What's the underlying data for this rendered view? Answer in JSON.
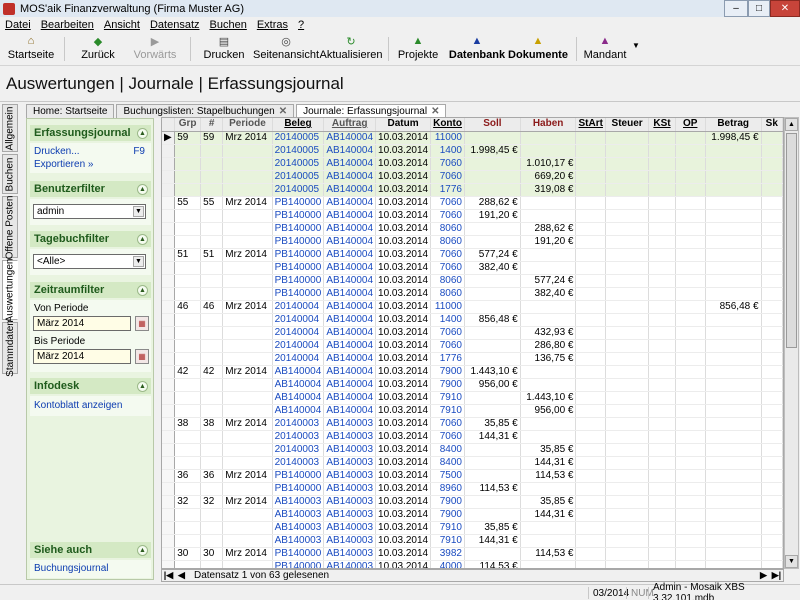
{
  "window": {
    "title": "MOS'aik Finanzverwaltung (Firma Muster AG)",
    "minimize": "–",
    "maximize": "□",
    "close": "✕"
  },
  "menu": [
    "Datei",
    "Bearbeiten",
    "Ansicht",
    "Datensatz",
    "Buchen",
    "Extras",
    "?"
  ],
  "toolbar": {
    "startseite": "Startseite",
    "zurueck": "Zurück",
    "vorwaerts": "Vorwärts",
    "drucken": "Drucken",
    "seitenansicht": "Seitenansicht",
    "aktualisieren": "Aktualisieren",
    "projekte": "Projekte",
    "datenbank": "Datenbank",
    "dokumente": "Dokumente",
    "mandant": "Mandant",
    "mandant_arrow": "▼",
    "icons": {
      "startseite": "⌂",
      "zurueck": "◆",
      "vorwaerts": "▶",
      "drucken": "▤",
      "seitenansicht": "◎",
      "aktualisieren": "↻",
      "projekte": "▲",
      "datenbank": "▲",
      "dokumente": "▲",
      "mandant": "▲"
    }
  },
  "page_title": "Auswertungen | Journale | Erfassungsjournal",
  "vertical_tabs": [
    "Allgemein",
    "Buchen",
    "Offene Posten",
    "Auswertungen",
    "Stammdaten"
  ],
  "doc_tabs": [
    {
      "label": "Home: Startseite",
      "close": ""
    },
    {
      "label": "Buchungslisten: Stapelbuchungen",
      "close": "✕"
    },
    {
      "label": "Journale: Erfassungsjournal",
      "close": "✕"
    }
  ],
  "sidebar": {
    "arrow": "▲",
    "erfassungsjournal": {
      "title": "Erfassungsjournal",
      "drucken": "Drucken...",
      "drucken_key": "F9",
      "exportieren": "Exportieren »"
    },
    "benutzerfilter": {
      "title": "Benutzerfilter",
      "value": "admin"
    },
    "tagebuchfilter": {
      "title": "Tagebuchfilter",
      "value": "<Alle>"
    },
    "zeitraumfilter": {
      "title": "Zeitraumfilter",
      "von_label": "Von Periode",
      "von_value": "März 2014",
      "bis_label": "Bis Periode",
      "bis_value": "März 2014",
      "cal_icon": "▦"
    },
    "infodesk": {
      "title": "Infodesk",
      "link": "Kontoblatt anzeigen"
    },
    "siehe_auch": {
      "title": "Siehe auch",
      "link": "Buchungsjournal"
    }
  },
  "grid": {
    "columns": [
      "Grp",
      "#",
      "Periode",
      "Beleg",
      "Auftrag",
      "Datum",
      "Konto",
      "Soll",
      "Haben",
      "StArt",
      "Steuer",
      "KSt",
      "OP",
      "Betrag",
      "Sk"
    ],
    "current_marker": "▶",
    "rows": [
      [
        "59",
        "59",
        "Mrz 2014",
        "20140005",
        "AB140004",
        "10.03.2014",
        "11000",
        "",
        "",
        "",
        "",
        "",
        "",
        "1.998,45 €",
        ""
      ],
      [
        "",
        "",
        "",
        "20140005",
        "AB140004",
        "10.03.2014",
        "1400",
        "1.998,45 €",
        "",
        "",
        "",
        "",
        "",
        "",
        ""
      ],
      [
        "",
        "",
        "",
        "20140005",
        "AB140004",
        "10.03.2014",
        "7060",
        "",
        "1.010,17 €",
        "",
        "",
        "",
        "",
        "",
        ""
      ],
      [
        "",
        "",
        "",
        "20140005",
        "AB140004",
        "10.03.2014",
        "7060",
        "",
        "669,20 €",
        "",
        "",
        "",
        "",
        "",
        ""
      ],
      [
        "",
        "",
        "",
        "20140005",
        "AB140004",
        "10.03.2014",
        "1776",
        "",
        "319,08 €",
        "",
        "",
        "",
        "",
        "",
        ""
      ],
      [
        "55",
        "55",
        "Mrz 2014",
        "PB140000",
        "AB140004",
        "10.03.2014",
        "7060",
        "288,62 €",
        "",
        "",
        "",
        "",
        "",
        "",
        ""
      ],
      [
        "",
        "",
        "",
        "PB140000",
        "AB140004",
        "10.03.2014",
        "7060",
        "191,20 €",
        "",
        "",
        "",
        "",
        "",
        "",
        ""
      ],
      [
        "",
        "",
        "",
        "PB140000",
        "AB140004",
        "10.03.2014",
        "8060",
        "",
        "288,62 €",
        "",
        "",
        "",
        "",
        "",
        ""
      ],
      [
        "",
        "",
        "",
        "PB140000",
        "AB140004",
        "10.03.2014",
        "8060",
        "",
        "191,20 €",
        "",
        "",
        "",
        "",
        "",
        ""
      ],
      [
        "51",
        "51",
        "Mrz 2014",
        "PB140000",
        "AB140004",
        "10.03.2014",
        "7060",
        "577,24 €",
        "",
        "",
        "",
        "",
        "",
        "",
        ""
      ],
      [
        "",
        "",
        "",
        "PB140000",
        "AB140004",
        "10.03.2014",
        "7060",
        "382,40 €",
        "",
        "",
        "",
        "",
        "",
        "",
        ""
      ],
      [
        "",
        "",
        "",
        "PB140000",
        "AB140004",
        "10.03.2014",
        "8060",
        "",
        "577,24 €",
        "",
        "",
        "",
        "",
        "",
        ""
      ],
      [
        "",
        "",
        "",
        "PB140000",
        "AB140004",
        "10.03.2014",
        "8060",
        "",
        "382,40 €",
        "",
        "",
        "",
        "",
        "",
        ""
      ],
      [
        "46",
        "46",
        "Mrz 2014",
        "20140004",
        "AB140004",
        "10.03.2014",
        "11000",
        "",
        "",
        "",
        "",
        "",
        "",
        "856,48 €",
        ""
      ],
      [
        "",
        "",
        "",
        "20140004",
        "AB140004",
        "10.03.2014",
        "1400",
        "856,48 €",
        "",
        "",
        "",
        "",
        "",
        "",
        ""
      ],
      [
        "",
        "",
        "",
        "20140004",
        "AB140004",
        "10.03.2014",
        "7060",
        "",
        "432,93 €",
        "",
        "",
        "",
        "",
        "",
        ""
      ],
      [
        "",
        "",
        "",
        "20140004",
        "AB140004",
        "10.03.2014",
        "7060",
        "",
        "286,80 €",
        "",
        "",
        "",
        "",
        "",
        ""
      ],
      [
        "",
        "",
        "",
        "20140004",
        "AB140004",
        "10.03.2014",
        "1776",
        "",
        "136,75 €",
        "",
        "",
        "",
        "",
        "",
        ""
      ],
      [
        "42",
        "42",
        "Mrz 2014",
        "AB140004",
        "AB140004",
        "10.03.2014",
        "7900",
        "1.443,10 €",
        "",
        "",
        "",
        "",
        "",
        "",
        ""
      ],
      [
        "",
        "",
        "",
        "AB140004",
        "AB140004",
        "10.03.2014",
        "7900",
        "956,00 €",
        "",
        "",
        "",
        "",
        "",
        "",
        ""
      ],
      [
        "",
        "",
        "",
        "AB140004",
        "AB140004",
        "10.03.2014",
        "7910",
        "",
        "1.443,10 €",
        "",
        "",
        "",
        "",
        "",
        ""
      ],
      [
        "",
        "",
        "",
        "AB140004",
        "AB140004",
        "10.03.2014",
        "7910",
        "",
        "956,00 €",
        "",
        "",
        "",
        "",
        "",
        ""
      ],
      [
        "38",
        "38",
        "Mrz 2014",
        "20140003",
        "AB140003",
        "10.03.2014",
        "7060",
        "35,85 €",
        "",
        "",
        "",
        "",
        "",
        "",
        ""
      ],
      [
        "",
        "",
        "",
        "20140003",
        "AB140003",
        "10.03.2014",
        "7060",
        "144,31 €",
        "",
        "",
        "",
        "",
        "",
        "",
        ""
      ],
      [
        "",
        "",
        "",
        "20140003",
        "AB140003",
        "10.03.2014",
        "8400",
        "",
        "35,85 €",
        "",
        "",
        "",
        "",
        "",
        ""
      ],
      [
        "",
        "",
        "",
        "20140003",
        "AB140003",
        "10.03.2014",
        "8400",
        "",
        "144,31 €",
        "",
        "",
        "",
        "",
        "",
        ""
      ],
      [
        "36",
        "36",
        "Mrz 2014",
        "PB140000",
        "AB140003",
        "10.03.2014",
        "7500",
        "",
        "114,53 €",
        "",
        "",
        "",
        "",
        "",
        ""
      ],
      [
        "",
        "",
        "",
        "PB140000",
        "AB140003",
        "10.03.2014",
        "8960",
        "114,53 €",
        "",
        "",
        "",
        "",
        "",
        "",
        ""
      ],
      [
        "32",
        "32",
        "Mrz 2014",
        "AB140003",
        "AB140003",
        "10.03.2014",
        "7900",
        "",
        "35,85 €",
        "",
        "",
        "",
        "",
        "",
        ""
      ],
      [
        "",
        "",
        "",
        "AB140003",
        "AB140003",
        "10.03.2014",
        "7900",
        "",
        "144,31 €",
        "",
        "",
        "",
        "",
        "",
        ""
      ],
      [
        "",
        "",
        "",
        "AB140003",
        "AB140003",
        "10.03.2014",
        "7910",
        "35,85 €",
        "",
        "",
        "",
        "",
        "",
        "",
        ""
      ],
      [
        "",
        "",
        "",
        "AB140003",
        "AB140003",
        "10.03.2014",
        "7910",
        "144,31 €",
        "",
        "",
        "",
        "",
        "",
        "",
        ""
      ],
      [
        "30",
        "30",
        "Mrz 2014",
        "PB140000",
        "AB140003",
        "10.03.2014",
        "3982",
        "",
        "114,53 €",
        "",
        "",
        "",
        "",
        "",
        ""
      ],
      [
        "",
        "",
        "",
        "PB140000",
        "AB140003",
        "10.03.2014",
        "4000",
        "114,53 €",
        "",
        "",
        "",
        "",
        "",
        "",
        ""
      ]
    ]
  },
  "scrollbar": {
    "up": "▲",
    "down": "▼"
  },
  "navigation": {
    "first": "|◀",
    "prev": "◀",
    "status": "Datensatz 1 von 63 gelesenen",
    "next": "▶",
    "last": "▶|"
  },
  "statusbar": {
    "period": "03/2014",
    "num": "NUM",
    "info": "Admin - Mosaik XBS 3.32.101.mdb"
  },
  "colors": {
    "panel_bg": "#e9f4e0",
    "section_head": "#d4e9c4",
    "highlight_row": "#e8f3dc",
    "link": "#1a4bc0"
  }
}
